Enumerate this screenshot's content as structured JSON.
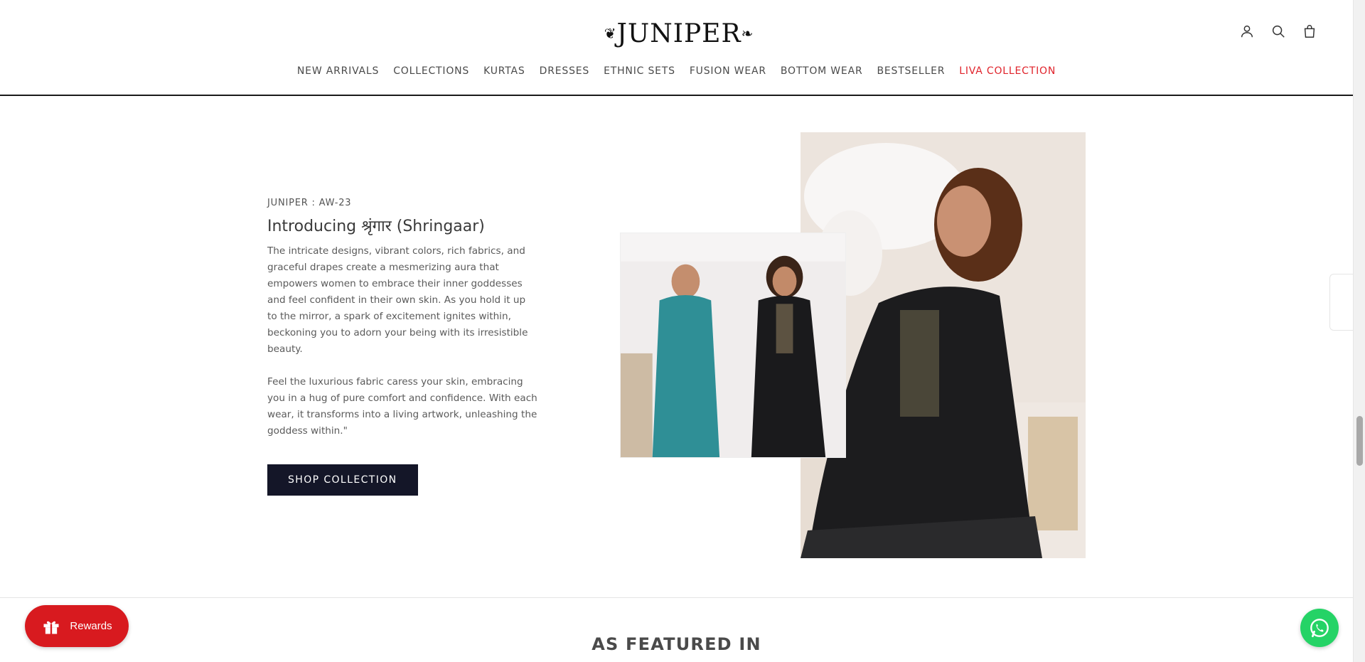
{
  "header": {
    "logo_text": "JUNIPER",
    "icons": [
      "account-icon",
      "search-icon",
      "cart-icon"
    ]
  },
  "nav": {
    "items": [
      {
        "label": "NEW ARRIVALS"
      },
      {
        "label": "COLLECTIONS"
      },
      {
        "label": "KURTAS"
      },
      {
        "label": "DRESSES"
      },
      {
        "label": "ETHNIC SETS"
      },
      {
        "label": "FUSION WEAR"
      },
      {
        "label": "BOTTOM WEAR"
      },
      {
        "label": "BESTSELLER"
      },
      {
        "label": "LIVA COLLECTION"
      }
    ],
    "highlight_color": "#e0232b"
  },
  "feature": {
    "eyebrow": "JUNIPER : AW-23",
    "headline": "Introducing श्रृंगार (Shringaar)",
    "paragraph_1": "The intricate designs, vibrant colors, rich fabrics, and graceful drapes create a mesmerizing aura that empowers women to embrace their inner goddesses and feel confident in their own skin. As you hold it up to the mirror, a spark of excitement ignites within, beckoning you to adorn your being with its irresistible beauty.",
    "paragraph_2": "Feel the luxurious fabric caress your skin, embracing you in a hug of pure comfort and confidence. With each wear, it transforms into a living artwork, unleashing the goddess within.\"",
    "cta_label": "SHOP COLLECTION",
    "cta_color": "#141628"
  },
  "featured_heading": "AS FEATURED IN",
  "widgets": {
    "rewards_label": "Rewards",
    "rewards_color": "#d81a1f",
    "whatsapp_color": "#25d366"
  }
}
